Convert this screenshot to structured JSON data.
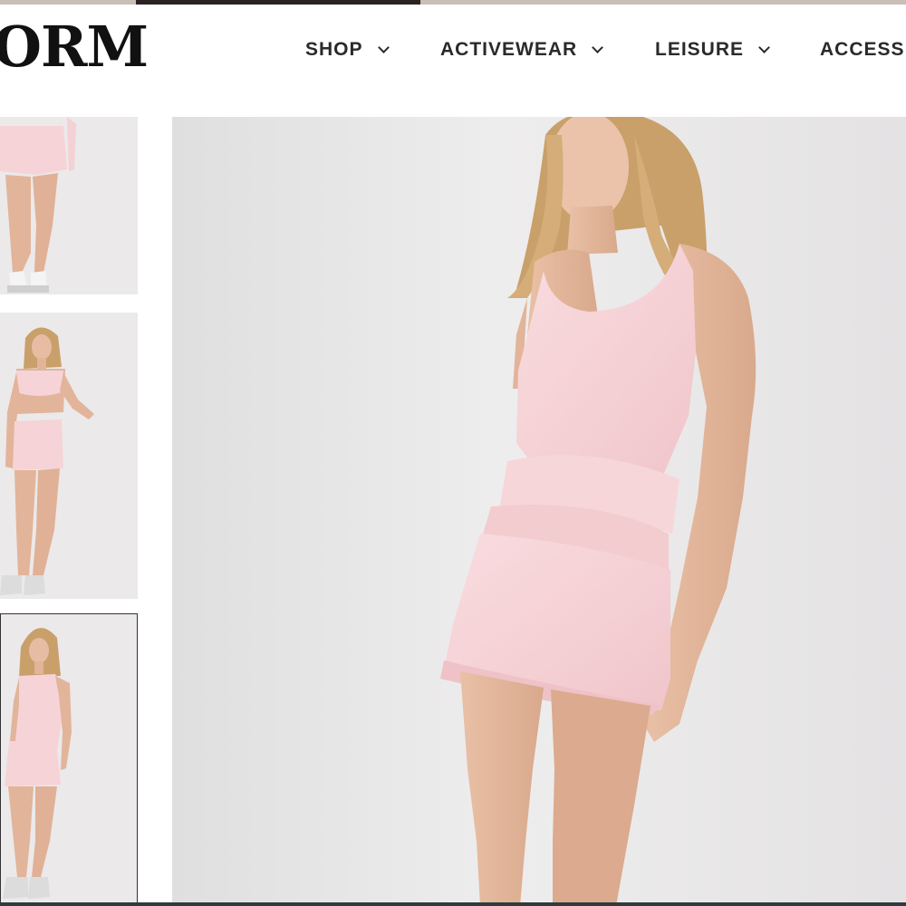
{
  "brand": {
    "logo_text": "ORM"
  },
  "nav": {
    "items": [
      {
        "label": "SHOP",
        "has_dropdown": true
      },
      {
        "label": "ACTIVEWEAR",
        "has_dropdown": true
      },
      {
        "label": "LEISURE",
        "has_dropdown": true
      },
      {
        "label": "ACCESS",
        "has_dropdown": false
      }
    ]
  },
  "gallery": {
    "thumbnails": [
      {
        "name": "thumbnail-back-view",
        "selected": false
      },
      {
        "name": "thumbnail-front-crop-top-set",
        "selected": false
      },
      {
        "name": "thumbnail-front-tank-dress",
        "selected": true
      }
    ],
    "main_image": "product-main-image-pink-tank-dress"
  },
  "colors": {
    "garment_pink": "#f6d3d6",
    "skin": "#e2b49a",
    "hair": "#c9a06a",
    "background": "#e8e6e7",
    "text": "#2a2a2a"
  }
}
